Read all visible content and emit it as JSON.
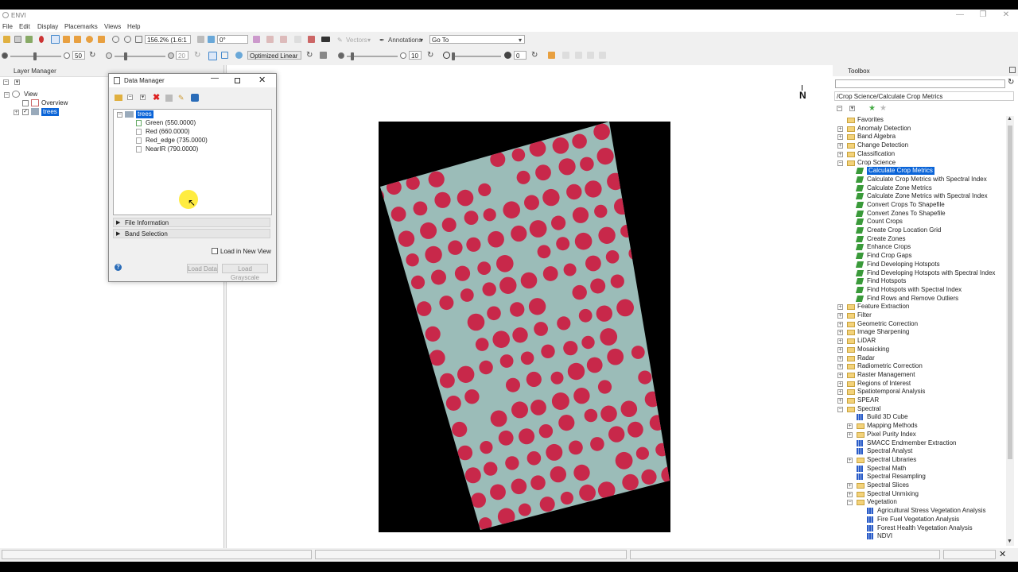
{
  "window": {
    "title": "ENVI"
  },
  "menu": [
    "File",
    "Edit",
    "Display",
    "Placemarks",
    "Views",
    "Help"
  ],
  "toolbar1": {
    "zoom_value": "156.2% (1.6:1",
    "rotation_value": "0°",
    "vectors_label": "Vectors",
    "annotations_label": "Annotations",
    "goto_value": "Go To"
  },
  "toolbar2": {
    "brightness_value": "50",
    "contrast_value": "20",
    "stretch_value": "Optimized Linear",
    "sharpen_value": "10",
    "transparency_value": "0"
  },
  "layer_manager": {
    "title": "Layer Manager",
    "root": "View",
    "items": [
      "Overview",
      "trees"
    ]
  },
  "data_manager": {
    "title": "Data Manager",
    "file": "trees",
    "bands": [
      "Green (550.0000)",
      "Red (660.0000)",
      "Red_edge (735.0000)",
      "NearIR (790.0000)"
    ],
    "sections": [
      "File Information",
      "Band Selection"
    ],
    "checkbox_label": "Load in New View",
    "load_data": "Load Data",
    "load_grayscale": "Load Grayscale"
  },
  "north_arrow": "N",
  "toolbox": {
    "title": "Toolbox",
    "search_value": "",
    "path": "/Crop Science/Calculate Crop Metrics",
    "folders_top": [
      "Favorites",
      "Anomaly Detection",
      "Band Algebra",
      "Change Detection",
      "Classification",
      "Crop Science"
    ],
    "crop_science_tools": [
      "Calculate Crop Metrics",
      "Calculate Crop Metrics with Spectral Index",
      "Calculate Zone Metrics",
      "Calculate Zone Metrics with Spectral Index",
      "Convert Crops To Shapefile",
      "Convert Zones To Shapefile",
      "Count Crops",
      "Create Crop Location Grid",
      "Create Zones",
      "Enhance Crops",
      "Find Crop Gaps",
      "Find Developing Hotspots",
      "Find Developing Hotspots with Spectral Index",
      "Find Hotspots",
      "Find Hotspots with Spectral Index",
      "Find Rows and Remove Outliers"
    ],
    "folders_mid": [
      "Feature Extraction",
      "Filter",
      "Geometric Correction",
      "Image Sharpening",
      "LiDAR",
      "Mosaicking",
      "Radar",
      "Radiometric Correction",
      "Raster Management",
      "Regions of Interest",
      "Spatiotemporal Analysis",
      "SPEAR",
      "Spectral"
    ],
    "spectral_items": [
      "Build 3D Cube",
      "Mapping Methods",
      "Pixel Purity Index",
      "SMACC Endmember Extraction",
      "Spectral Analyst",
      "Spectral Libraries",
      "Spectral Math",
      "Spectral Resampling",
      "Spectral Slices",
      "Spectral Unmixing",
      "Vegetation"
    ],
    "vegetation_items": [
      "Agricultural Stress Vegetation Analysis",
      "Fire Fuel Vegetation Analysis",
      "Forest Health Vegetation Analysis",
      "NDVI"
    ]
  },
  "colors": {
    "selection": "#0a64d8",
    "image_background": "#000000",
    "vegetation_red": "#c8284a",
    "ground_teal": "#9bbcb8"
  }
}
